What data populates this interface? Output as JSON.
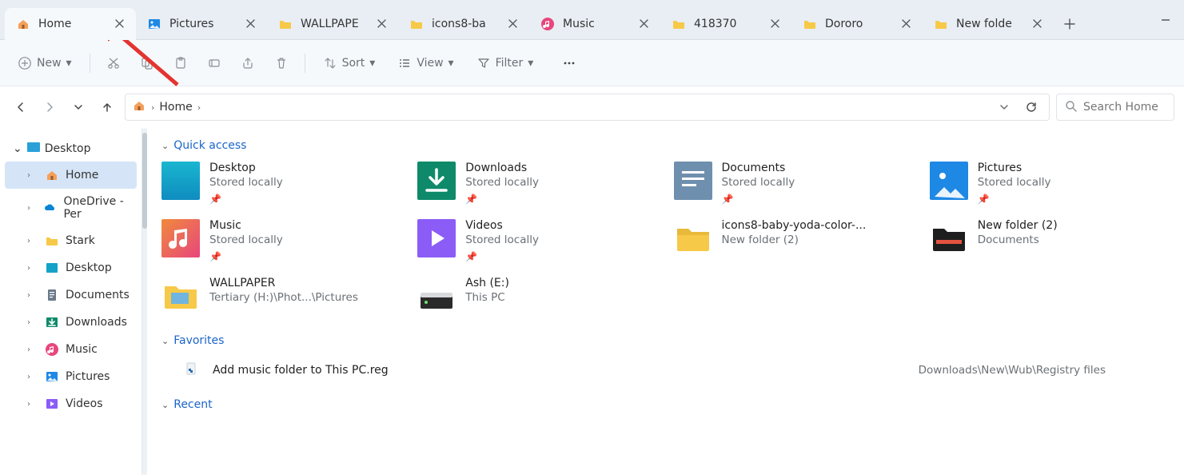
{
  "tabs": [
    {
      "label": "Home",
      "icon": "home"
    },
    {
      "label": "Pictures",
      "icon": "pictures"
    },
    {
      "label": "WALLPAPE",
      "icon": "folder"
    },
    {
      "label": "icons8-ba",
      "icon": "folder"
    },
    {
      "label": "Music",
      "icon": "music"
    },
    {
      "label": "418370",
      "icon": "folder"
    },
    {
      "label": "Dororo",
      "icon": "folder"
    },
    {
      "label": "New folde",
      "icon": "folder"
    }
  ],
  "toolbar": {
    "new": "New",
    "sort": "Sort",
    "view": "View",
    "filter": "Filter"
  },
  "breadcrumb": {
    "root": "Home"
  },
  "search": {
    "placeholder": "Search Home"
  },
  "sidebar": {
    "top": "Desktop",
    "items": [
      {
        "label": "Home",
        "selected": true,
        "icon": "home"
      },
      {
        "label": "OneDrive - Per",
        "icon": "onedrive"
      },
      {
        "label": "Stark",
        "icon": "folder"
      },
      {
        "label": "Desktop",
        "icon": "desktop"
      },
      {
        "label": "Documents",
        "icon": "doc"
      },
      {
        "label": "Downloads",
        "icon": "dl"
      },
      {
        "label": "Music",
        "icon": "music"
      },
      {
        "label": "Pictures",
        "icon": "pictures"
      },
      {
        "label": "Videos",
        "icon": "videos"
      }
    ]
  },
  "sections": {
    "quick": "Quick access",
    "fav": "Favorites",
    "recent": "Recent"
  },
  "quick_items": [
    {
      "title": "Desktop",
      "sub": "Stored locally",
      "pin": true,
      "icon": "desktop"
    },
    {
      "title": "Downloads",
      "sub": "Stored locally",
      "pin": true,
      "icon": "dl"
    },
    {
      "title": "Documents",
      "sub": "Stored locally",
      "pin": true,
      "icon": "doc"
    },
    {
      "title": "Pictures",
      "sub": "Stored locally",
      "pin": true,
      "icon": "pictures"
    },
    {
      "title": "Music",
      "sub": "Stored locally",
      "pin": true,
      "icon": "music"
    },
    {
      "title": "Videos",
      "sub": "Stored locally",
      "pin": true,
      "icon": "videos"
    },
    {
      "title": "icons8-baby-yoda-color-...",
      "sub": "New folder (2)",
      "icon": "folder"
    },
    {
      "title": "New folder (2)",
      "sub": "Documents",
      "icon": "folder-dark"
    },
    {
      "title": "WALLPAPER",
      "sub": "Tertiary (H:)\\Phot...\\Pictures",
      "icon": "folder-pic"
    },
    {
      "title": "Ash (E:)",
      "sub": "This PC",
      "icon": "drive"
    }
  ],
  "favorites": [
    {
      "title": "Add music folder to This PC.reg",
      "path": "Downloads\\New\\Wub\\Registry files"
    }
  ]
}
